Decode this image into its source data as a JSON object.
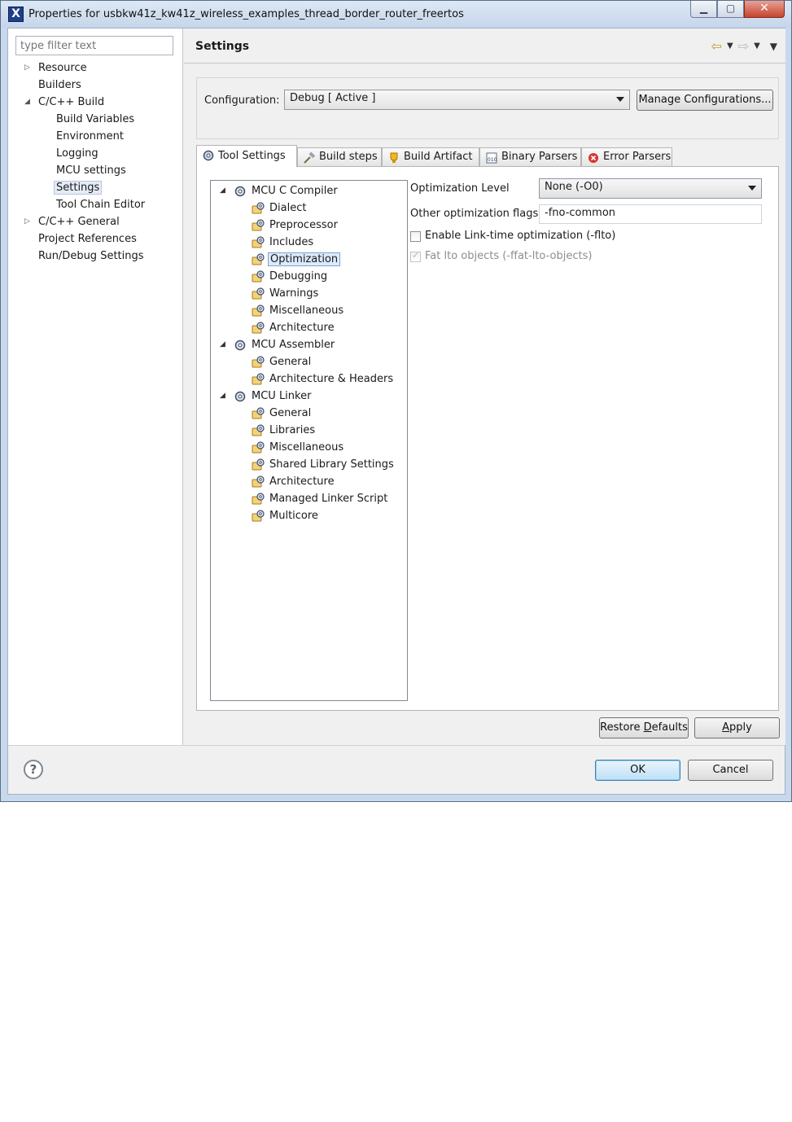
{
  "window": {
    "title": "Properties for usbkw41z_kw41z_wireless_examples_thread_border_router_freertos",
    "app_icon": "X",
    "minimize_glyph": "▁",
    "maximize_glyph": "▢",
    "close_glyph": "✕"
  },
  "filter": {
    "placeholder": "type filter text"
  },
  "nav": {
    "items": [
      {
        "label": "Resource",
        "twisty": "▷"
      },
      {
        "label": "Builders"
      },
      {
        "label": "C/C++ Build",
        "twisty": "◢"
      },
      {
        "label": "Build Variables"
      },
      {
        "label": "Environment"
      },
      {
        "label": "Logging"
      },
      {
        "label": "MCU settings"
      },
      {
        "label": "Settings",
        "selected": true
      },
      {
        "label": "Tool Chain Editor"
      },
      {
        "label": "C/C++ General",
        "twisty": "▷"
      },
      {
        "label": "Project References"
      },
      {
        "label": "Run/Debug Settings"
      }
    ]
  },
  "header": {
    "title": "Settings"
  },
  "config": {
    "label": "Configuration:",
    "value": "Debug  [ Active ]",
    "manage_label": "Manage Configurations..."
  },
  "tabs": [
    {
      "label": "Tool Settings",
      "icon": "gear-icon",
      "active": true
    },
    {
      "label": "Build steps",
      "icon": "hammer-icon"
    },
    {
      "label": "Build Artifact",
      "icon": "trophy-icon"
    },
    {
      "label": "Binary Parsers",
      "icon": "binary-icon"
    },
    {
      "label": "Error Parsers",
      "icon": "error-icon"
    }
  ],
  "tree": {
    "compiler": {
      "label": "MCU C Compiler",
      "children": [
        "Dialect",
        "Preprocessor",
        "Includes",
        "Optimization",
        "Debugging",
        "Warnings",
        "Miscellaneous",
        "Architecture"
      ]
    },
    "assembler": {
      "label": "MCU Assembler",
      "children": [
        "General",
        "Architecture & Headers"
      ]
    },
    "linker": {
      "label": "MCU Linker",
      "children": [
        "General",
        "Libraries",
        "Miscellaneous",
        "Shared Library Settings",
        "Architecture",
        "Managed Linker Script",
        "Multicore"
      ]
    },
    "twisty": "◢",
    "selected": "Optimization"
  },
  "settings": {
    "opt_level_label": "Optimization Level",
    "opt_level_value": "None (-O0)",
    "other_flags_label": "Other optimization flags",
    "other_flags_value": "-fno-common",
    "lto_label": "Enable Link-time optimization (-flto)",
    "lto_checked": false,
    "fat_lto_label": "Fat lto objects (-ffat-lto-objects)",
    "fat_lto_checked": true
  },
  "buttons": {
    "restore_prefix": "Restore ",
    "restore_underlined": "D",
    "restore_suffix": "efaults",
    "apply_underlined": "A",
    "apply_suffix": "pply",
    "ok": "OK",
    "cancel": "Cancel",
    "help": "?"
  },
  "colors": {
    "title_bar": "#c5d6ea",
    "close_button": "#c4452f",
    "selection": "#dceafc",
    "nav_arrow": "#c99a2c"
  }
}
